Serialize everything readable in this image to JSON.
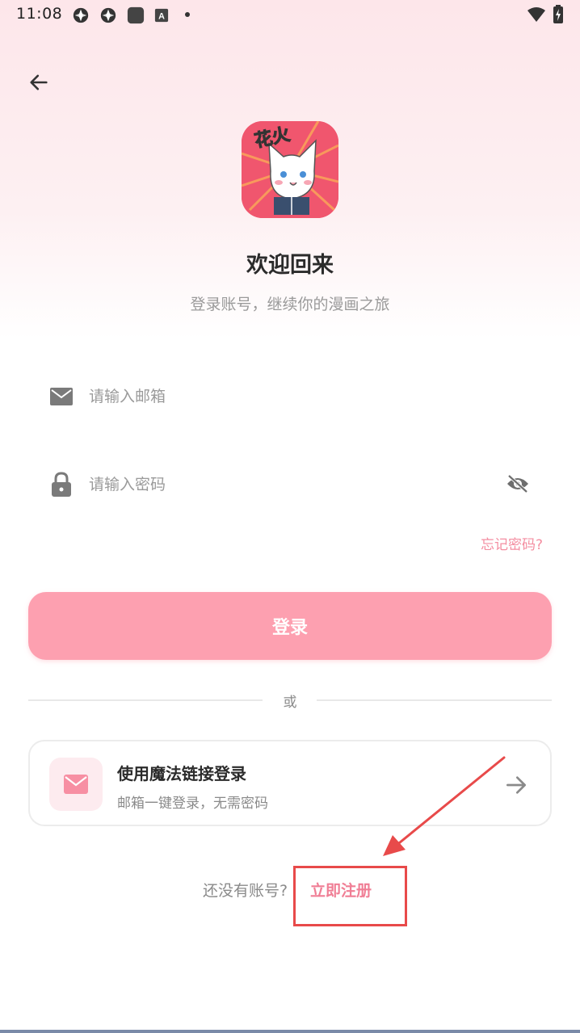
{
  "status_bar": {
    "time": "11:08",
    "icons": [
      "sync-icon",
      "sync-icon",
      "app-icon",
      "a11y-icon",
      "dot-icon"
    ],
    "right_icons": [
      "wifi-icon",
      "battery-charging-icon"
    ]
  },
  "header": {
    "back_icon": "arrow-left-icon"
  },
  "logo": {
    "text": "花火",
    "description": "cat-reading-book"
  },
  "welcome": {
    "title": "欢迎回来",
    "subtitle": "登录账号，继续你的漫画之旅"
  },
  "form": {
    "email_placeholder": "请输入邮箱",
    "email_value": "",
    "email_icon": "mail-icon",
    "password_placeholder": "请输入密码",
    "password_value": "",
    "password_icon": "lock-icon",
    "visibility_icon": "eye-off-icon",
    "forgot_password": "忘记密码?",
    "login_label": "登录"
  },
  "divider": {
    "text": "或"
  },
  "magic_link": {
    "title": "使用魔法链接登录",
    "subtitle": "邮箱一键登录，无需密码",
    "icon": "mail-icon",
    "arrow_icon": "arrow-right-icon"
  },
  "footer": {
    "no_account": "还没有账号?",
    "register": "立即注册"
  },
  "colors": {
    "accent": "#fda0b0",
    "link": "#f07e95",
    "annotation": "#e84a4a"
  }
}
